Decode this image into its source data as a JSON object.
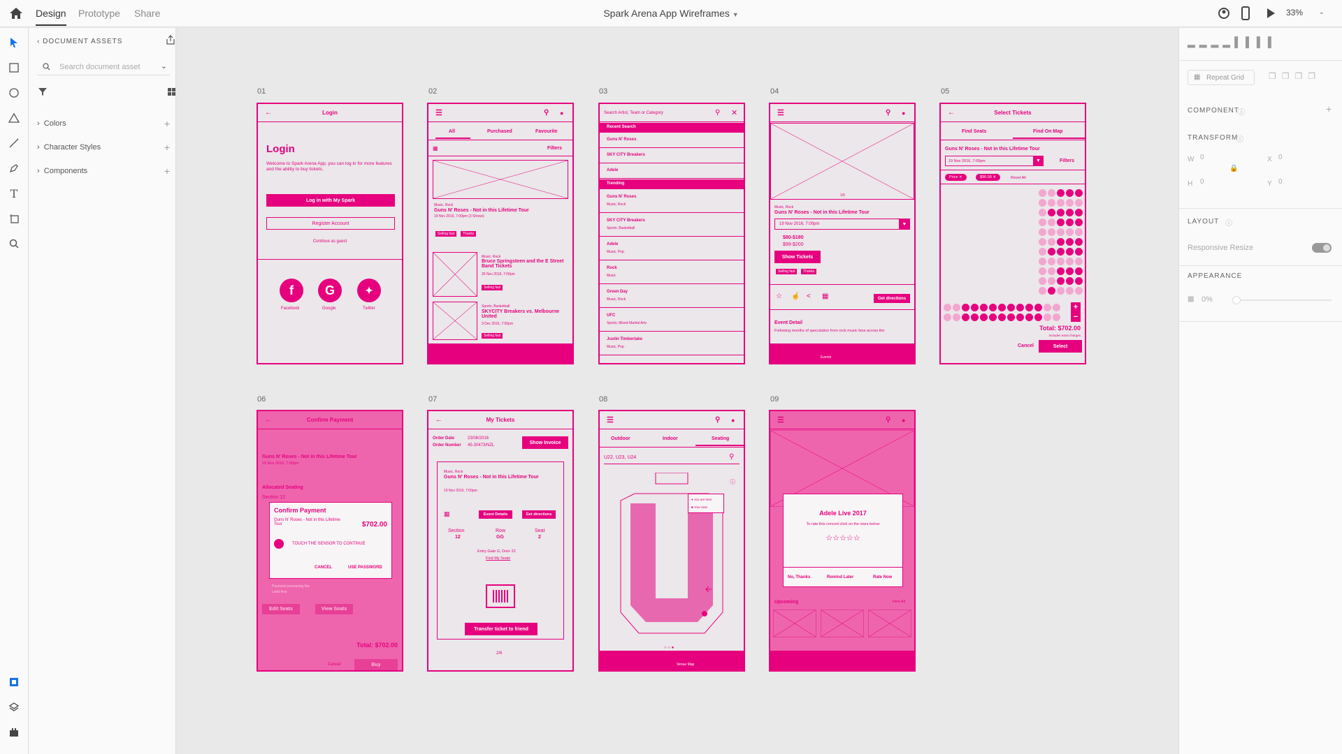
{
  "topbar": {
    "tabs": [
      "Design",
      "Prototype",
      "Share"
    ],
    "document_title": "Spark Arena App Wireframes",
    "zoom": "33%"
  },
  "left_panel": {
    "heading": "DOCUMENT ASSETS",
    "search_placeholder": "Search document asset",
    "sections": [
      "Colors",
      "Character Styles",
      "Components"
    ]
  },
  "right_panel": {
    "repeat_grid": "Repeat Grid",
    "component": "COMPONENT",
    "transform": "TRANSFORM",
    "w_label": "W",
    "w_value": "0",
    "x_label": "X",
    "x_value": "0",
    "h_label": "H",
    "h_value": "0",
    "y_label": "Y",
    "y_value": "0",
    "layout": "LAYOUT",
    "responsive_resize": "Responsive Resize",
    "appearance": "APPEARANCE",
    "opacity": "0%"
  },
  "artboards": {
    "ab1": {
      "num": "01",
      "header": "Login",
      "title": "Login",
      "intro": "Welcome to Spark Arena App, you can log in for more features and the ability to buy tickets.",
      "login_btn": "Log in with My Spark",
      "register_btn": "Register Account",
      "guest": "Continue as guest",
      "facebook": "Facebook",
      "google": "Google",
      "twitter": "Twitter"
    },
    "ab2": {
      "num": "02",
      "tabs": [
        "All",
        "Purchased",
        "Favourite"
      ],
      "filters": "Filters",
      "cat1": "Music, Rock",
      "event1": "Guns N' Roses - Not in this Lifetime Tour",
      "date1": "19 Nov 2016, 7:00pm (3 Shows)",
      "tag_selling": "Selling fast",
      "tag_thanks": "Thanks",
      "cat2": "Music, Rock",
      "event2": "Bruce Springsteen and the E Street Band Tickets",
      "date2": "26 Nov 2016, 7:00pm",
      "cat3": "Sports, Basketball",
      "event3": "SKYCITY Breakers vs. Melbourne United",
      "date3": "3 Dec 2016, 7:00pm"
    },
    "ab3": {
      "num": "03",
      "search_placeholder": "Search Artist, Team or Category",
      "recent": "Recent Search",
      "recent_items": [
        "Guns N' Roses",
        "SKY CITY Breakers",
        "Adele"
      ],
      "trending": "Trending",
      "trending_items": [
        {
          "name": "Guns N' Roses",
          "cat": "Music, Rock"
        },
        {
          "name": "SKY CITY Breakers",
          "cat": "Sports, Basketball"
        },
        {
          "name": "Adele",
          "cat": "Music, Pop"
        },
        {
          "name": "Rock",
          "cat": "Music"
        },
        {
          "name": "Green Day",
          "cat": "Music, Rock"
        },
        {
          "name": "UFC",
          "cat": "Sports, Mixed Martial Arts"
        },
        {
          "name": "Justin Timberlake",
          "cat": "Music, Pop"
        }
      ]
    },
    "ab4": {
      "num": "04",
      "pager": "1/5",
      "cat": "Music, Rock",
      "event": "Guns N' Roses - Not in this Lifetime Tour",
      "date": "19 Nov 2016, 7:00pm",
      "price1": "$80-$180",
      "price2": "$99-$200",
      "show_tickets": "Show Tickets",
      "get_directions": "Get directions",
      "event_detail": "Event Detail",
      "detail_text": "Following months of speculation from rock music fans across the",
      "nav_events": "Events"
    },
    "ab5": {
      "num": "05",
      "header": "Select Tickets",
      "tabs": [
        "Find Seats",
        "Find On Map"
      ],
      "event": "Guns N' Roses - Not in this Lifetime Tour",
      "date": "19 Nov 2016, 7:00pm",
      "filters": "Filters",
      "chip_price": "Price",
      "chip_amount": "$90.00",
      "reset": "Reset All",
      "total": "Total: $702.00",
      "total_note": "Includes extra charges",
      "cancel": "Cancel",
      "select": "Select"
    },
    "ab6": {
      "num": "06",
      "header": "Confirm Payment",
      "event": "Guns N' Roses - Not in this Lifetime Tour",
      "date": "19 Nov 2016, 7:00pm",
      "allocated": "Allocated Seating",
      "section": "Section 12",
      "dialog_title": "Confirm Payment",
      "dialog_event": "Guns N' Roses - Not in this Lifetime Tour",
      "dialog_price": "$702.00",
      "touch": "TOUCH THE SENSOR TO CONTINUE",
      "cancel": "CANCEL",
      "use_password": "USE PASSWORD",
      "fee": "Payment processing fee",
      "levy": "Land levy",
      "edit_seats": "Edit Seats",
      "view_seats": "View Seats",
      "total": "Total: $702.00",
      "cancel2": "Cancel",
      "buy": "Buy"
    },
    "ab7": {
      "num": "07",
      "header": "My Tickets",
      "order_date_label": "Order Date",
      "order_date": "23/06/2016",
      "order_number_label": "Order Number",
      "order_number": "45-30473/NZL",
      "show_invoice": "Show Invoice",
      "cat": "Music, Rock",
      "event": "Guns N' Roses - Not in this Lifetime Tour",
      "date": "19 Nov 2016, 7:00pm",
      "event_details": "Event Details",
      "get_directions": "Get directions",
      "section_label": "Section",
      "section": "12",
      "row_label": "Row",
      "row": "GG",
      "seat_label": "Seat",
      "seat": "2",
      "entry": "Entry Gate G, Door 22",
      "find_seats": "Find My Seats",
      "transfer": "Transfer ticket to friend",
      "page": "2/6"
    },
    "ab8": {
      "num": "08",
      "tabs": [
        "Outdoor",
        "Indoor",
        "Seating"
      ],
      "search": "U22, U23, U24",
      "you_are_here": "You are here",
      "your_seat": "Your seat",
      "nav_label": "Venue Map"
    },
    "ab9": {
      "num": "09",
      "dialog_title": "Adele Live 2017",
      "dialog_text": "To rate this concert click on the stars below",
      "no_thanks": "No, Thanks",
      "remind": "Remind Later",
      "rate": "Rate Now",
      "upcoming": "Upcoming",
      "view_all": "View All"
    }
  },
  "colors": {
    "accent": "#e6007e",
    "canvas": "#e9e9e9"
  }
}
